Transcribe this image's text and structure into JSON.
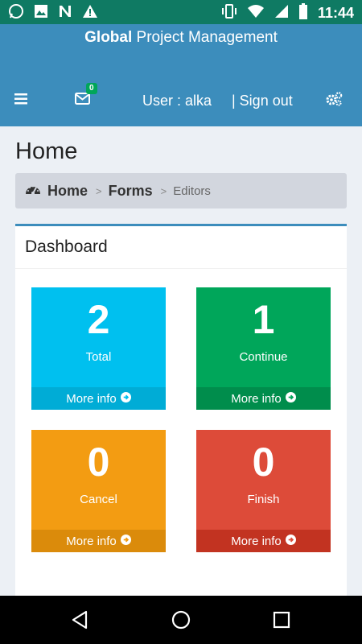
{
  "status_bar": {
    "time": "11:44",
    "left_icons": [
      "whatsapp-icon",
      "image-icon",
      "n-app-icon",
      "warning-icon"
    ],
    "right_icons": [
      "vibrate-icon",
      "wifi-icon",
      "signal-icon",
      "battery-icon"
    ]
  },
  "app": {
    "title_bold": "Global",
    "title_rest": " Project Management"
  },
  "navbar": {
    "mail_badge": "0",
    "user_text": "User : alka",
    "signout_text": "| Sign out"
  },
  "page": {
    "title": "Home"
  },
  "breadcrumb": {
    "items": [
      "Home",
      "Forms",
      "Editors"
    ]
  },
  "dashboard": {
    "title": "Dashboard",
    "tiles": [
      {
        "count": "2",
        "label": "Total",
        "more": "More info",
        "color": "#00c0ef",
        "footer_color": "#00acd6"
      },
      {
        "count": "1",
        "label": "Continue",
        "more": "More info",
        "color": "#00a65a",
        "footer_color": "#008d4c"
      },
      {
        "count": "0",
        "label": "Cancel",
        "more": "More info",
        "color": "#f39c12",
        "footer_color": "#db8b0b"
      },
      {
        "count": "0",
        "label": "Finish",
        "more": "More info",
        "color": "#dd4b39",
        "footer_color": "#c23321"
      }
    ]
  },
  "colors": {
    "header": "#3c8dbc",
    "status_bar": "#0f7a63",
    "background": "#ecf0f5"
  }
}
